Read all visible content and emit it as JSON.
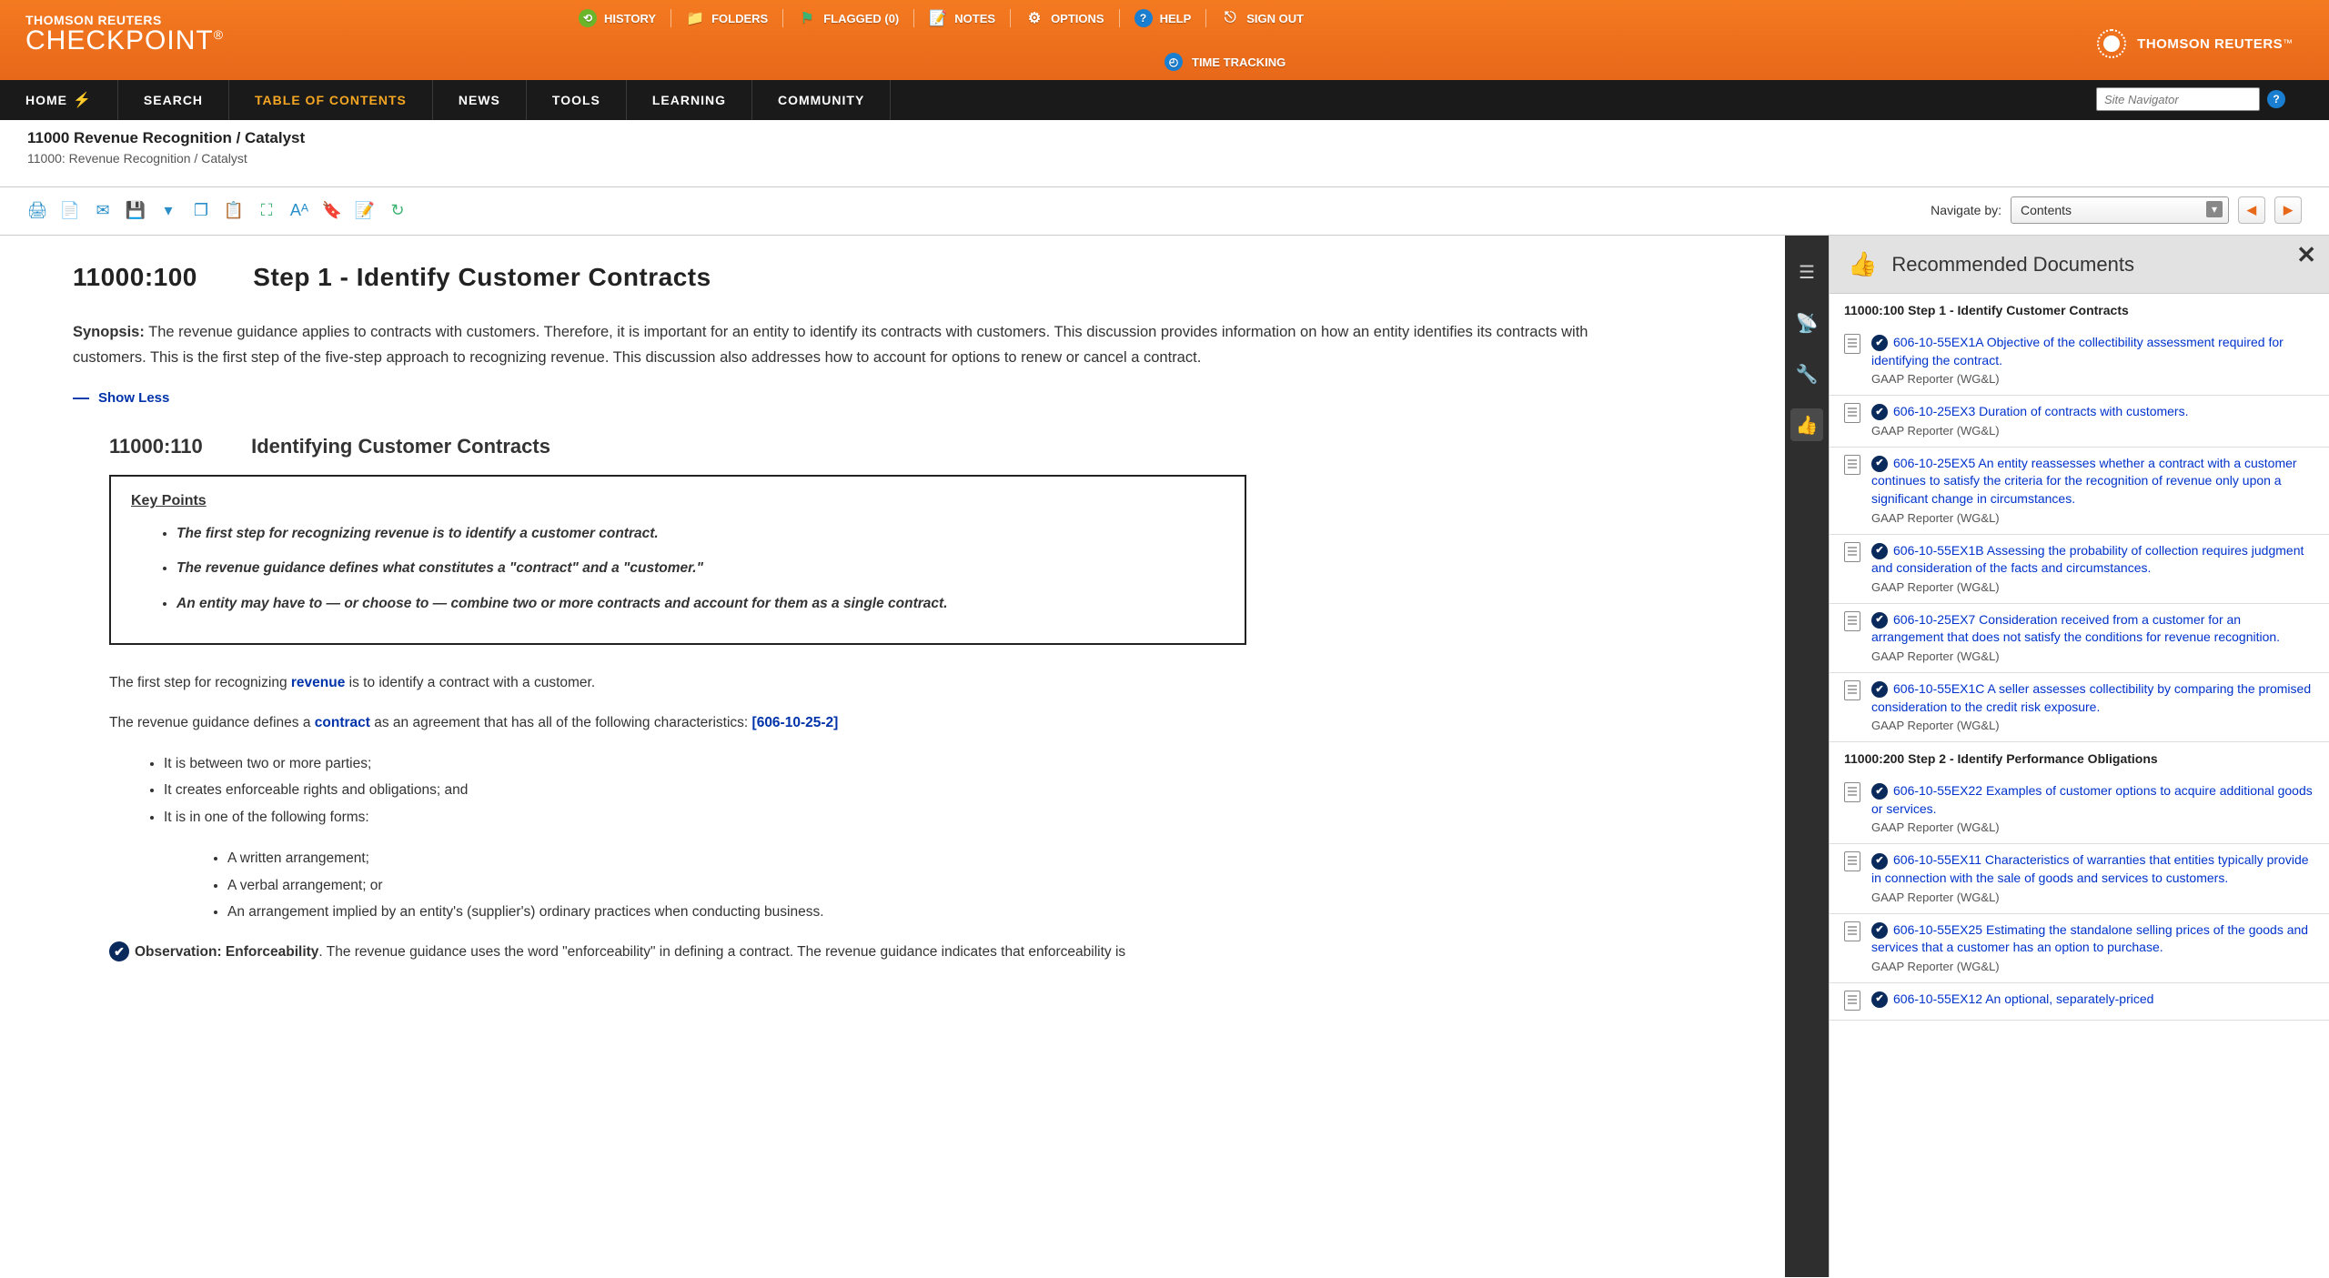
{
  "brand": {
    "sup": "THOMSON REUTERS",
    "main": "CHECKPOINT",
    "right_text": "THOMSON REUTERS"
  },
  "utility": {
    "history": "HISTORY",
    "folders": "FOLDERS",
    "flagged": "FLAGGED (0)",
    "notes": "NOTES",
    "options": "OPTIONS",
    "help": "HELP",
    "signout": "SIGN OUT",
    "time_tracking": "TIME TRACKING"
  },
  "nav": {
    "home": "HOME",
    "search": "SEARCH",
    "toc": "TABLE OF CONTENTS",
    "news": "NEWS",
    "tools": "TOOLS",
    "learning": "LEARNING",
    "community": "COMMUNITY",
    "site_navigator_placeholder": "Site Navigator"
  },
  "doc_path": {
    "title": "11000 Revenue Recognition / Catalyst",
    "sub": "11000: Revenue Recognition / Catalyst"
  },
  "toolbar": {
    "navigate_by": "Navigate by:",
    "nav_select_value": "Contents"
  },
  "content": {
    "section_id": "11000:100",
    "section_title": "Step 1 - Identify Customer Contracts",
    "synopsis_label": "Synopsis:",
    "synopsis_text": "The revenue guidance applies to contracts with customers. Therefore, it is important for an entity to identify its contracts with customers. This discussion provides information on how an entity identifies its contracts with customers. This is the first step of the five-step approach to recognizing revenue. This discussion also addresses how to account for options to renew or cancel a contract.",
    "show_less": "Show Less",
    "sub_id": "11000:110",
    "sub_title": "Identifying Customer Contracts",
    "key_points_title": "Key Points",
    "key_points": [
      "The first step for recognizing revenue is to identify a customer contract.",
      "The revenue guidance defines what constitutes a \"contract\" and a \"customer.\"",
      "An entity may have to — or choose to — combine two or more contracts and account for them as a single contract."
    ],
    "p1_pre": "The first step for recognizing ",
    "p1_link": "revenue",
    "p1_post": " is to identify a contract with a customer.",
    "p2_pre": "The revenue guidance defines a ",
    "p2_link": "contract",
    "p2_mid": " as an agreement that has all of the following characteristics: ",
    "p2_ref": "[606-10-25-2]",
    "char_list": [
      "It is between two or more parties;",
      "It creates enforceable rights and obligations; and",
      "It is in one of the following forms:"
    ],
    "form_list": [
      "A written arrangement;",
      "A verbal arrangement; or",
      "An arrangement implied by an entity's (supplier's) ordinary practices when conducting business."
    ],
    "obs_label": "Observation: Enforceability",
    "obs_text": ". The revenue guidance uses the word \"enforceability\" in defining a contract. The revenue guidance indicates that enforceability is"
  },
  "rec": {
    "header": "Recommended Documents",
    "sections": [
      {
        "title": "11000:100 Step 1 - Identify Customer Contracts",
        "items": [
          {
            "link": "606-10-55EX1A Objective of the collectibility assessment required for identifying the contract.",
            "source": "GAAP Reporter (WG&L)"
          },
          {
            "link": "606-10-25EX3 Duration of contracts with customers.",
            "source": "GAAP Reporter (WG&L)"
          },
          {
            "link": "606-10-25EX5 An entity reassesses whether a contract with a customer continues to satisfy the criteria for the recognition of revenue only upon a significant change in circumstances.",
            "source": "GAAP Reporter (WG&L)"
          },
          {
            "link": "606-10-55EX1B Assessing the probability of collection requires judgment and consideration of the facts and circumstances.",
            "source": "GAAP Reporter (WG&L)"
          },
          {
            "link": "606-10-25EX7 Consideration received from a customer for an arrangement that does not satisfy the conditions for revenue recognition.",
            "source": "GAAP Reporter (WG&L)"
          },
          {
            "link": "606-10-55EX1C A seller assesses collectibility by comparing the promised consideration to the credit risk exposure.",
            "source": "GAAP Reporter (WG&L)"
          }
        ]
      },
      {
        "title": "11000:200 Step 2 - Identify Performance Obligations",
        "items": [
          {
            "link": "606-10-55EX22 Examples of customer options to acquire additional goods or services.",
            "source": "GAAP Reporter (WG&L)"
          },
          {
            "link": "606-10-55EX11 Characteristics of warranties that entities typically provide in connection with the sale of goods and services to customers.",
            "source": "GAAP Reporter (WG&L)"
          },
          {
            "link": "606-10-55EX25 Estimating the standalone selling prices of the goods and services that a customer has an option to purchase.",
            "source": "GAAP Reporter (WG&L)"
          },
          {
            "link": "606-10-55EX12 An optional, separately-priced",
            "source": ""
          }
        ]
      }
    ]
  }
}
